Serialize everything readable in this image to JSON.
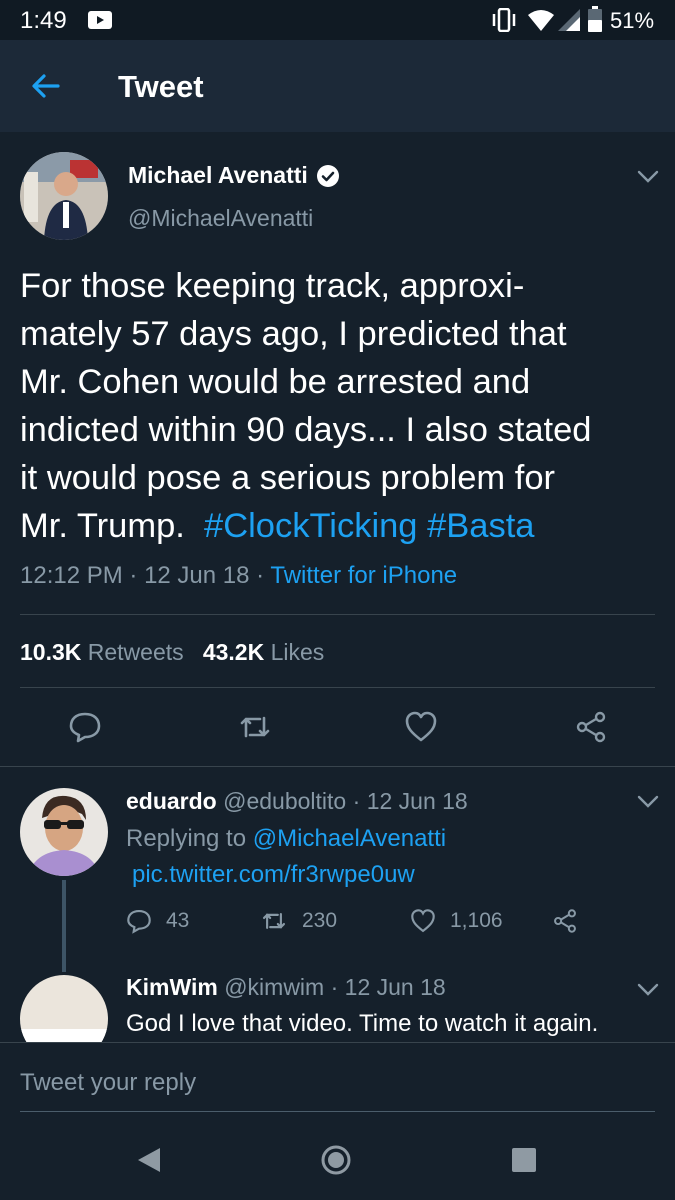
{
  "status_bar": {
    "time": "1:49",
    "battery": "51%",
    "icons": [
      "screen-record-icon",
      "vibrate-icon",
      "wifi-icon",
      "signal-icon",
      "battery-icon"
    ]
  },
  "app_bar": {
    "title": "Tweet",
    "back_icon": "arrow-left-icon"
  },
  "tweet": {
    "author_name": "Michael Avenatti",
    "handle": "@MichaelAvenatti",
    "verified": true,
    "text_lines": [
      "For those keeping track, approxi-",
      "mately 57 days ago, I predicted that",
      "Mr. Cohen would be arrested and",
      "indicted within 90 days... I also stated",
      "it would pose a serious problem for"
    ],
    "text_last": "Mr. Trump.",
    "hashtags": [
      "#ClockTicking",
      "#Basta"
    ],
    "time": "12:12 PM",
    "date": "12 Jun 18",
    "source": "Twitter for iPhone",
    "retweets_count": "10.3K",
    "retweets_label": "Retweets",
    "likes_count": "43.2K",
    "likes_label": "Likes"
  },
  "replies": [
    {
      "name": "eduardo",
      "handle": "@eduboltito",
      "date": "12 Jun 18",
      "replying_prefix": "Replying to",
      "replying_to": "@MichaelAvenatti",
      "link": "pic.twitter.com/fr3rwpe0uw",
      "reply_count": "43",
      "retweet_count": "230",
      "like_count": "1,106"
    },
    {
      "name": "KimWim",
      "handle": "@kimwim",
      "date": "12 Jun 18",
      "text": "God I love that video. Time to watch it again."
    }
  ],
  "compose": {
    "placeholder": "Tweet your reply"
  },
  "colors": {
    "background": "#15202b",
    "app_bar": "#1c2938",
    "accent": "#1da1f2",
    "secondary_text": "#8899a6",
    "divider": "#38444d"
  }
}
